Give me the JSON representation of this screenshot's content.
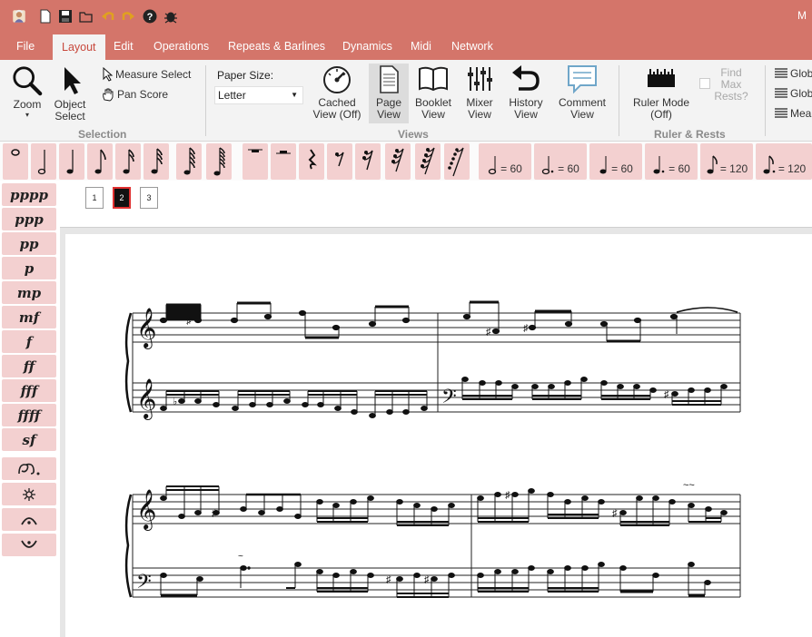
{
  "titlebar": {
    "title_fragment": "M"
  },
  "menu": {
    "items": [
      "File",
      "Layout",
      "Edit",
      "Operations",
      "Repeats & Barlines",
      "Dynamics",
      "Midi",
      "Network"
    ],
    "active": "Layout"
  },
  "ribbon": {
    "zoom": "Zoom",
    "object_select": "Object Select",
    "measure_select": "Measure Select",
    "pan_score": "Pan Score",
    "paper_size_label": "Paper Size:",
    "paper_size_value": "Letter",
    "cached_view": "Cached View (Off)",
    "page_view": "Page View",
    "booklet_view": "Booklet View",
    "mixer_view": "Mixer View",
    "history_view": "History View",
    "comment_view": "Comment View",
    "ruler_mode": "Ruler Mode (Off)",
    "find_max_rests": "Find Max Rests?",
    "global1": "Glob",
    "global2": "Glob",
    "measure": "Mea",
    "groups": {
      "selection": "Selection",
      "views": "Views",
      "ruler": "Ruler & Rests"
    }
  },
  "tempo_marks": [
    "= 60",
    "= 60",
    "= 60",
    "= 60",
    "= 120",
    "= 120"
  ],
  "dynamics": [
    "pppp",
    "ppp",
    "pp",
    "p",
    "mp",
    "mf",
    "f",
    "ff",
    "fff",
    "ffff",
    "sf"
  ],
  "pages": [
    "1",
    "2",
    "3"
  ],
  "active_page": "2"
}
